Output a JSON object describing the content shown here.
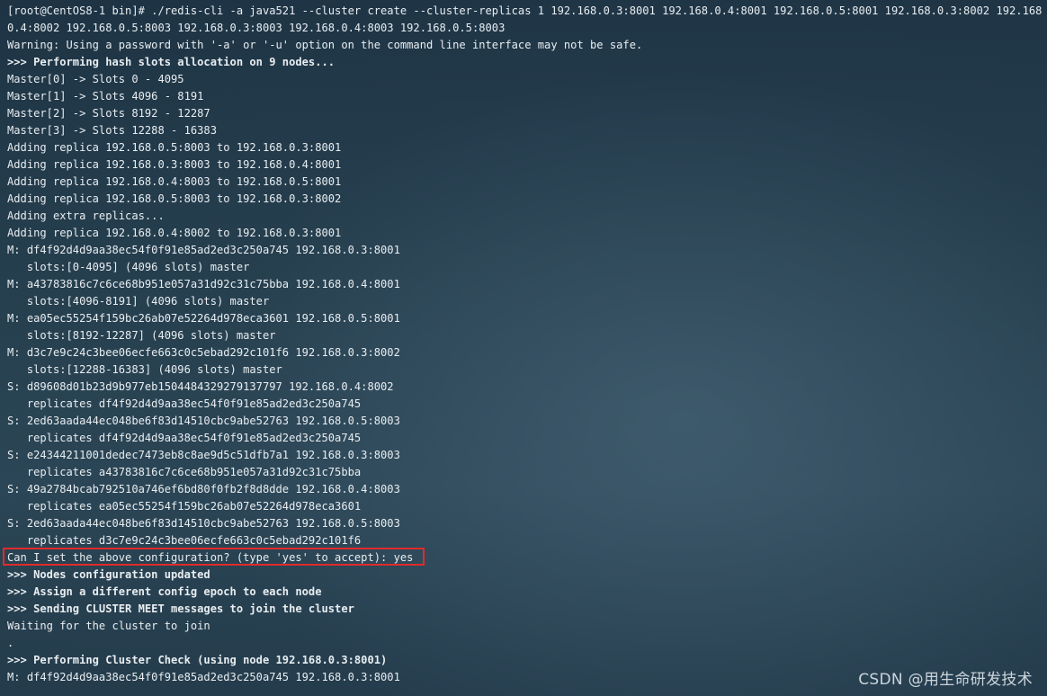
{
  "terminal": {
    "lines": [
      {
        "text": "[root@CentOS8-1 bin]# ./redis-cli -a java521 --cluster create --cluster-replicas 1 192.168.0.3:8001 192.168.0.4:8001 192.168.0.5:8001 192.168.0.3:8002 192.168.",
        "bold": false
      },
      {
        "text": "0.4:8002 192.168.0.5:8003 192.168.0.3:8003 192.168.0.4:8003 192.168.0.5:8003",
        "bold": false
      },
      {
        "text": "Warning: Using a password with '-a' or '-u' option on the command line interface may not be safe.",
        "bold": false
      },
      {
        "text": ">>> Performing hash slots allocation on 9 nodes...",
        "bold": true
      },
      {
        "text": "Master[0] -> Slots 0 - 4095",
        "bold": false
      },
      {
        "text": "Master[1] -> Slots 4096 - 8191",
        "bold": false
      },
      {
        "text": "Master[2] -> Slots 8192 - 12287",
        "bold": false
      },
      {
        "text": "Master[3] -> Slots 12288 - 16383",
        "bold": false
      },
      {
        "text": "Adding replica 192.168.0.5:8003 to 192.168.0.3:8001",
        "bold": false
      },
      {
        "text": "Adding replica 192.168.0.3:8003 to 192.168.0.4:8001",
        "bold": false
      },
      {
        "text": "Adding replica 192.168.0.4:8003 to 192.168.0.5:8001",
        "bold": false
      },
      {
        "text": "Adding replica 192.168.0.5:8003 to 192.168.0.3:8002",
        "bold": false
      },
      {
        "text": "Adding extra replicas...",
        "bold": false
      },
      {
        "text": "Adding replica 192.168.0.4:8002 to 192.168.0.3:8001",
        "bold": false
      },
      {
        "text": "M: df4f92d4d9aa38ec54f0f91e85ad2ed3c250a745 192.168.0.3:8001",
        "bold": false
      },
      {
        "text": "   slots:[0-4095] (4096 slots) master",
        "bold": false
      },
      {
        "text": "M: a43783816c7c6ce68b951e057a31d92c31c75bba 192.168.0.4:8001",
        "bold": false
      },
      {
        "text": "   slots:[4096-8191] (4096 slots) master",
        "bold": false
      },
      {
        "text": "M: ea05ec55254f159bc26ab07e52264d978eca3601 192.168.0.5:8001",
        "bold": false
      },
      {
        "text": "   slots:[8192-12287] (4096 slots) master",
        "bold": false
      },
      {
        "text": "M: d3c7e9c24c3bee06ecfe663c0c5ebad292c101f6 192.168.0.3:8002",
        "bold": false
      },
      {
        "text": "   slots:[12288-16383] (4096 slots) master",
        "bold": false
      },
      {
        "text": "S: d89608d01b23d9b977eb1504484329279137797 192.168.0.4:8002",
        "bold": false
      },
      {
        "text": "   replicates df4f92d4d9aa38ec54f0f91e85ad2ed3c250a745",
        "bold": false
      },
      {
        "text": "S: 2ed63aada44ec048be6f83d14510cbc9abe52763 192.168.0.5:8003",
        "bold": false
      },
      {
        "text": "   replicates df4f92d4d9aa38ec54f0f91e85ad2ed3c250a745",
        "bold": false
      },
      {
        "text": "S: e24344211001dedec7473eb8c8ae9d5c51dfb7a1 192.168.0.3:8003",
        "bold": false
      },
      {
        "text": "   replicates a43783816c7c6ce68b951e057a31d92c31c75bba",
        "bold": false
      },
      {
        "text": "S: 49a2784bcab792510a746ef6bd80f0fb2f8d8dde 192.168.0.4:8003",
        "bold": false
      },
      {
        "text": "   replicates ea05ec55254f159bc26ab07e52264d978eca3601",
        "bold": false
      },
      {
        "text": "S: 2ed63aada44ec048be6f83d14510cbc9abe52763 192.168.0.5:8003",
        "bold": false
      },
      {
        "text": "   replicates d3c7e9c24c3bee06ecfe663c0c5ebad292c101f6",
        "bold": false
      },
      {
        "text": "Can I set the above configuration? (type 'yes' to accept): yes",
        "bold": false
      },
      {
        "text": ">>> Nodes configuration updated",
        "bold": true
      },
      {
        "text": ">>> Assign a different config epoch to each node",
        "bold": true
      },
      {
        "text": ">>> Sending CLUSTER MEET messages to join the cluster",
        "bold": true
      },
      {
        "text": "Waiting for the cluster to join",
        "bold": false
      },
      {
        "text": ".",
        "bold": false
      },
      {
        "text": ">>> Performing Cluster Check (using node 192.168.0.3:8001)",
        "bold": true
      },
      {
        "text": "M: df4f92d4d9aa38ec54f0f91e85ad2ed3c250a745 192.168.0.3:8001",
        "bold": false
      }
    ]
  },
  "watermark": {
    "text": "CSDN @用生命研发技术"
  },
  "colors": {
    "terminal_text": "#e8edf0",
    "highlight_border": "#e02b2b",
    "background": "#26404f"
  }
}
